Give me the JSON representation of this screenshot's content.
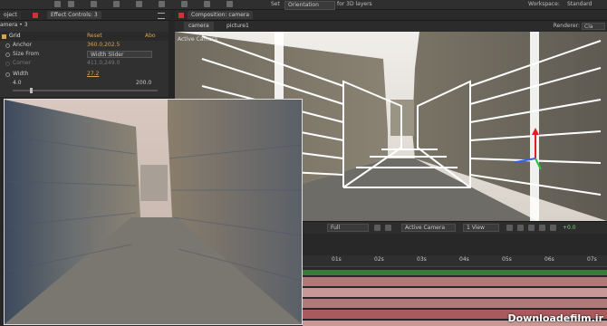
{
  "toolbar": {
    "set_label": "Set",
    "orientation_value": "Orientation",
    "for_3d_layers": "for 3D layers",
    "workspace_label": "Workspace:",
    "workspace_value": "Standard"
  },
  "left_tabs": {
    "project_tab": "oject",
    "effect_controls_tab": "Effect Controls: 3"
  },
  "effect_controls": {
    "layer_name": "amera • 3",
    "effect_name": "Grid",
    "reset_label": "Reset",
    "about_label": "Abo",
    "rows": [
      {
        "label": "Anchor",
        "value": "360.0,202.5"
      },
      {
        "label": "Size From",
        "value": "Width Slider"
      },
      {
        "label": "Corner",
        "value": "411.0,249.0"
      },
      {
        "label": "Width",
        "value": "27.2"
      }
    ],
    "slider_min": "4.0",
    "slider_max": "200.0",
    "slider_fraction": 0.12
  },
  "composition": {
    "panel_tab": "Composition: camera",
    "tabs": [
      "camera",
      "picture1"
    ],
    "renderer_label": "Renderer:",
    "renderer_value": "Cla",
    "active_camera_label": "Active Camera"
  },
  "viewer_bar": {
    "resolution": "Full",
    "camera": "Active Camera",
    "views": "1 View",
    "exposure": "+0.0"
  },
  "timeline": {
    "ticks": [
      "01s",
      "02s",
      "03s",
      "04s",
      "05s",
      "06s",
      "07s"
    ]
  },
  "watermark": "Downloadefilm.ir",
  "colors": {
    "accent_orange": "#d9a24c",
    "grid_white": "#ffffff",
    "axis_red": "#e02020",
    "axis_green": "#20c040",
    "axis_blue": "#3060ff"
  }
}
